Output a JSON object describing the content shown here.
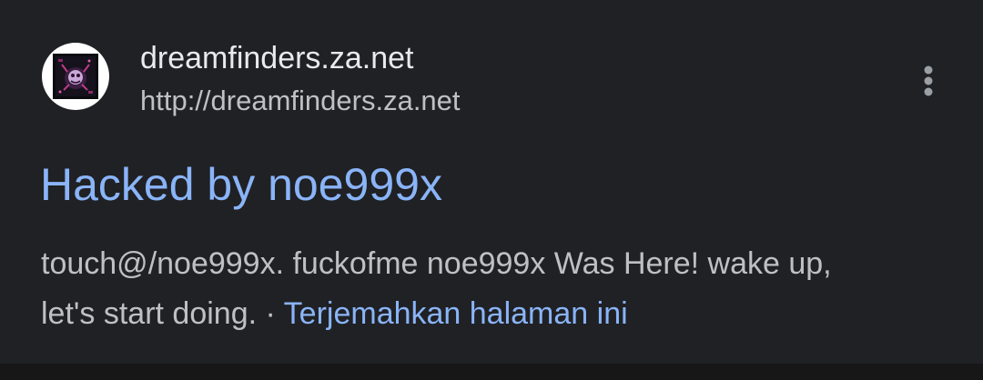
{
  "result": {
    "site_name": "dreamfinders.za.net",
    "site_url": "http://dreamfinders.za.net",
    "favicon_icon": "site-favicon-icon",
    "menu_icon": "more-vert-icon",
    "title": "Hacked by noe999x",
    "snippet_line1": "touch@/noe999x. fuckofme noe999x Was Here! wake up,",
    "snippet_line2": "let's start doing.",
    "separator": " · ",
    "translate_label": "Terjemahkan halaman ini"
  },
  "colors": {
    "background": "#202124",
    "title_link": "#8ab4f8",
    "primary_text": "#e8eaed",
    "secondary_text": "#bdc1c6"
  }
}
